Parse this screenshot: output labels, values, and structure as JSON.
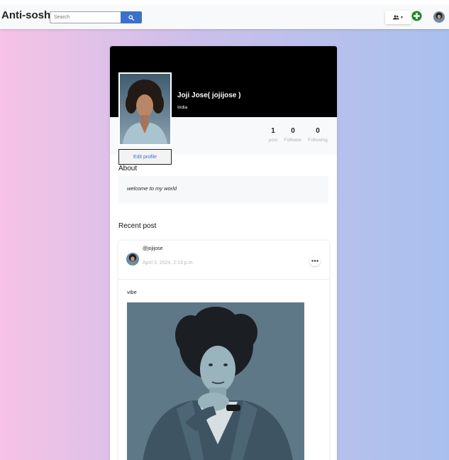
{
  "nav": {
    "brand": "Anti-sosh",
    "search_placeholder": "Search",
    "search_icon": "search-icon",
    "friends_icon": "users-icon",
    "add_icon": "plus-circle-icon"
  },
  "profile": {
    "name": "Joji Jose( jojijose )",
    "location": "India",
    "edit_label": "Edit profile",
    "stats": [
      {
        "value": "1",
        "label": "post"
      },
      {
        "value": "0",
        "label": "Follower"
      },
      {
        "value": "0",
        "label": "Following"
      }
    ]
  },
  "about": {
    "title": "About",
    "text": "welcome to my world"
  },
  "recent": {
    "title": "Recent post",
    "post": {
      "username": "@jojijose",
      "date": "April 3, 2024, 2:13 p.m.",
      "caption": "vibe"
    }
  },
  "colors": {
    "accent": "#3b71ca",
    "add_green": "#198b1e",
    "cover": "#000000"
  }
}
